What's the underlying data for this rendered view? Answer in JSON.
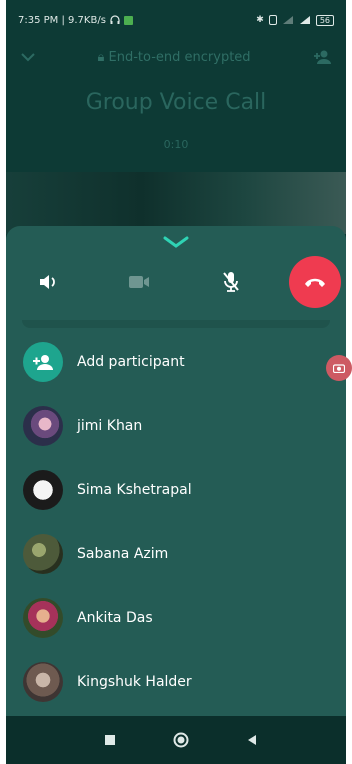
{
  "status_bar": {
    "time_speed": "7:35 PM | 9.7KB/s",
    "battery": "56"
  },
  "header": {
    "encryption_text": "End-to-end encrypted",
    "title": "Group Voice Call",
    "timer": "0:10"
  },
  "controls": {
    "speaker": "speaker-icon",
    "video": "video-icon",
    "mute": "mic-muted-icon",
    "end_call": "end-call-icon",
    "end_call_color": "#ef3b50"
  },
  "participants": {
    "add_label": "Add participant",
    "items": [
      {
        "name": "jimi Khan"
      },
      {
        "name": "Sima Kshetrapal"
      },
      {
        "name": "Sabana Azim"
      },
      {
        "name": "Ankita Das"
      },
      {
        "name": "Kingshuk Halder"
      }
    ]
  },
  "colors": {
    "background": "#0d3a35",
    "sheet": "#245c55",
    "accent": "#1ea58e"
  }
}
